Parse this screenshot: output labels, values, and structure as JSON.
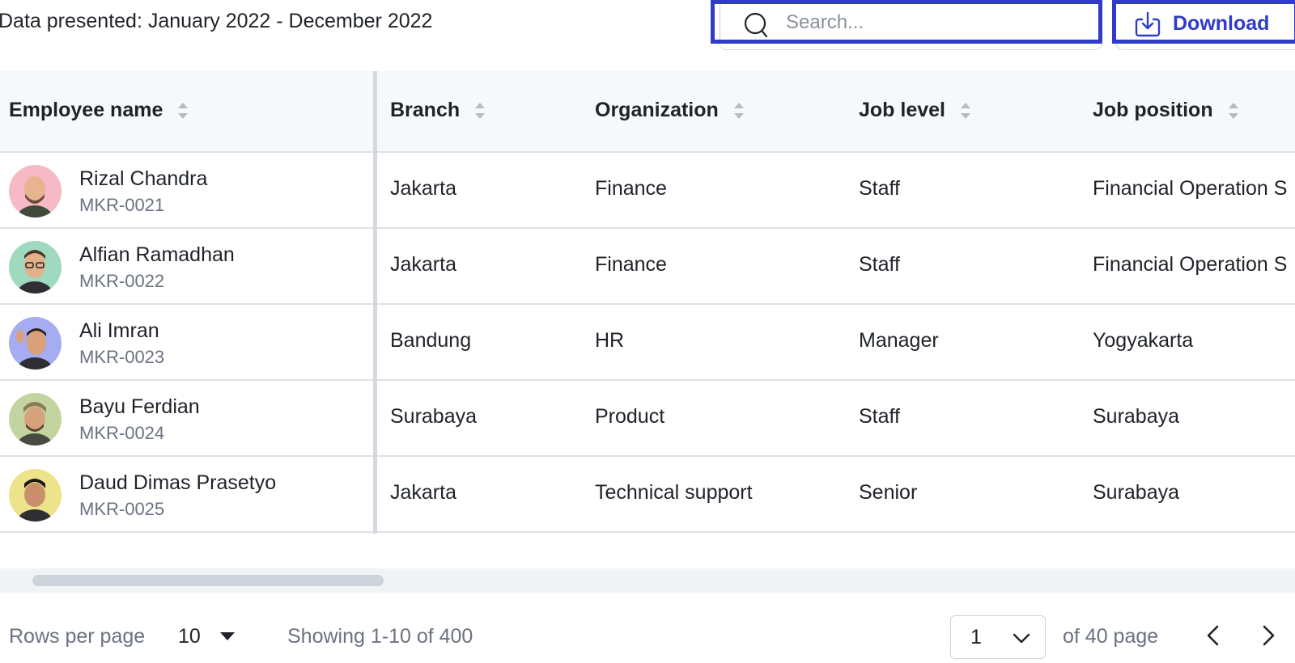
{
  "header": {
    "date_range": "Data presented: January 2022 - December 2022",
    "search_placeholder": "Search...",
    "search_value": "",
    "download_label": "Download",
    "accent_color": "#2f3cc9"
  },
  "table": {
    "columns": [
      "Employee name",
      "Branch",
      "Organization",
      "Job level",
      "Job position"
    ],
    "rows": [
      {
        "name": "Rizal Chandra",
        "id": "MKR-0021",
        "branch": "Jakarta",
        "organization": "Finance",
        "job_level": "Staff",
        "job_position": "Financial Operation S",
        "avatar_color": "#f7b9c6"
      },
      {
        "name": "Alfian Ramadhan",
        "id": "MKR-0022",
        "branch": "Jakarta",
        "organization": "Finance",
        "job_level": "Staff",
        "job_position": "Financial Operation S",
        "avatar_color": "#9fd9c0"
      },
      {
        "name": "Ali Imran",
        "id": "MKR-0023",
        "branch": "Bandung",
        "organization": "HR",
        "job_level": "Manager",
        "job_position": "Yogyakarta",
        "avatar_color": "#a6acf2"
      },
      {
        "name": "Bayu Ferdian",
        "id": "MKR-0024",
        "branch": "Surabaya",
        "organization": "Product",
        "job_level": "Staff",
        "job_position": "Surabaya",
        "avatar_color": "#c3d4a1"
      },
      {
        "name": "Daud Dimas Prasetyo",
        "id": "MKR-0025",
        "branch": "Jakarta",
        "organization": "Technical support",
        "job_level": "Senior",
        "job_position": "Surabaya",
        "avatar_color": "#ede38b"
      }
    ]
  },
  "footer": {
    "rows_per_page_label": "Rows per page",
    "rows_per_page_value": "10",
    "showing_text": "Showing 1-10 of 400",
    "current_page": "1",
    "of_pages_text": "of 40 page"
  },
  "icons": {
    "search": "search-icon",
    "download": "download-icon",
    "sort": "sort-icon",
    "chevron_down": "chevron-down-icon",
    "prev": "chevron-left-icon",
    "next": "chevron-right-icon"
  }
}
